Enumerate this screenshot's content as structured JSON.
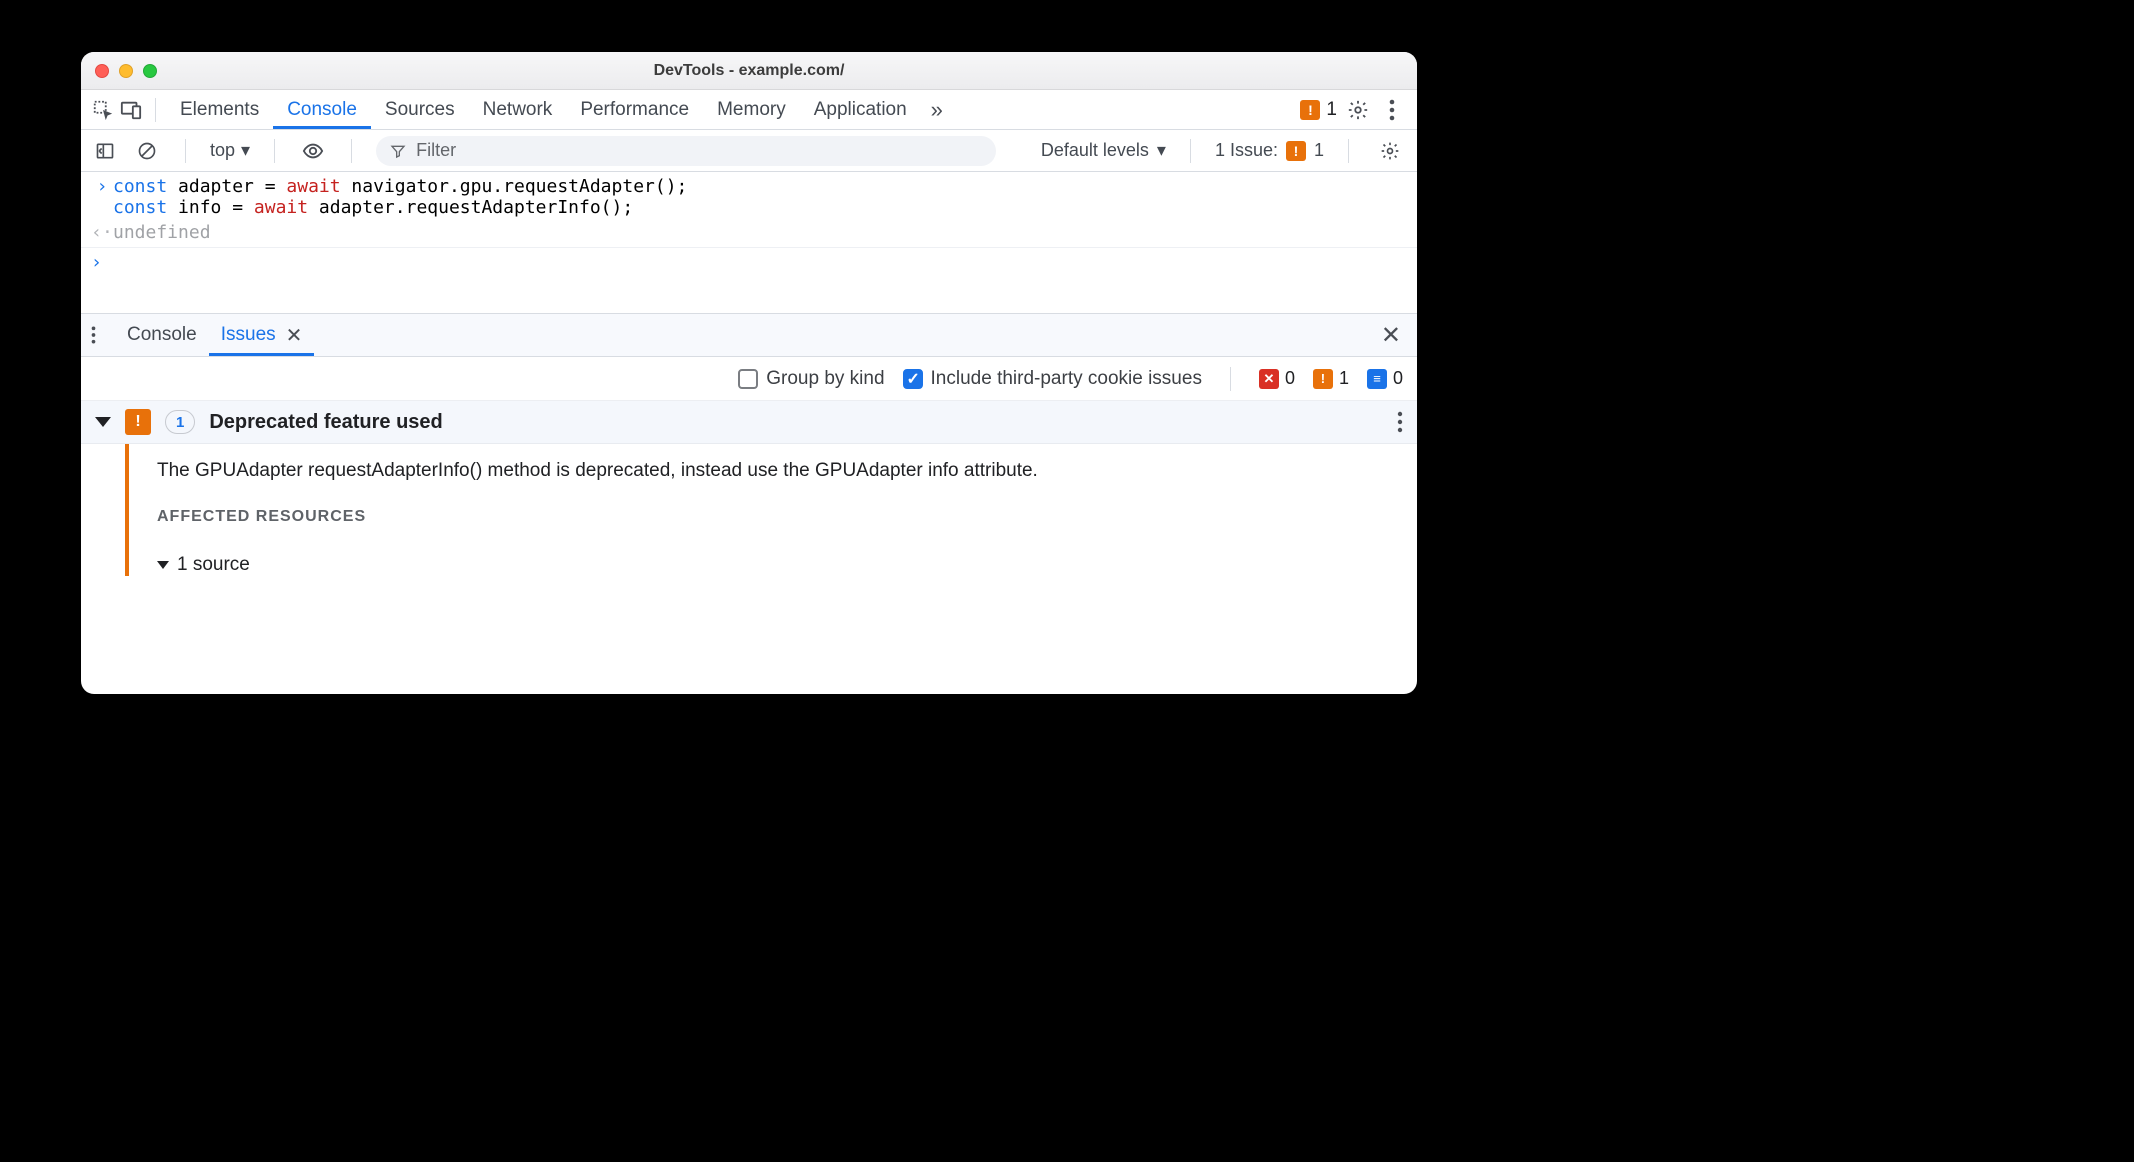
{
  "window_title": "DevTools - example.com/",
  "tabs": [
    "Elements",
    "Console",
    "Sources",
    "Network",
    "Performance",
    "Memory",
    "Application"
  ],
  "active_tab": "Console",
  "main_counts": {
    "warn": "1"
  },
  "filterbar": {
    "context": "top",
    "filter_placeholder": "Filter",
    "levels_label": "Default levels",
    "issue_label": "1 Issue:",
    "issue_count": "1"
  },
  "console": {
    "line1_pre": "const",
    "line1_var": " adapter = ",
    "line1_await": "await",
    "line1_rest": " navigator.gpu.requestAdapter();",
    "line2_pre": "const",
    "line2_var": " info = ",
    "line2_await": "await",
    "line2_rest": " adapter.requestAdapterInfo();",
    "result": "undefined"
  },
  "drawer": {
    "tabs": [
      "Console",
      "Issues"
    ],
    "active": "Issues"
  },
  "issues_opts": {
    "group_label": "Group by kind",
    "include_label": "Include third-party cookie issues",
    "err": "0",
    "warn": "1",
    "info": "0"
  },
  "issue": {
    "count": "1",
    "title": "Deprecated feature used",
    "message": "The GPUAdapter requestAdapterInfo() method is deprecated, instead use the GPUAdapter info attribute.",
    "affected_label": "AFFECTED RESOURCES",
    "source_label": "1 source"
  }
}
